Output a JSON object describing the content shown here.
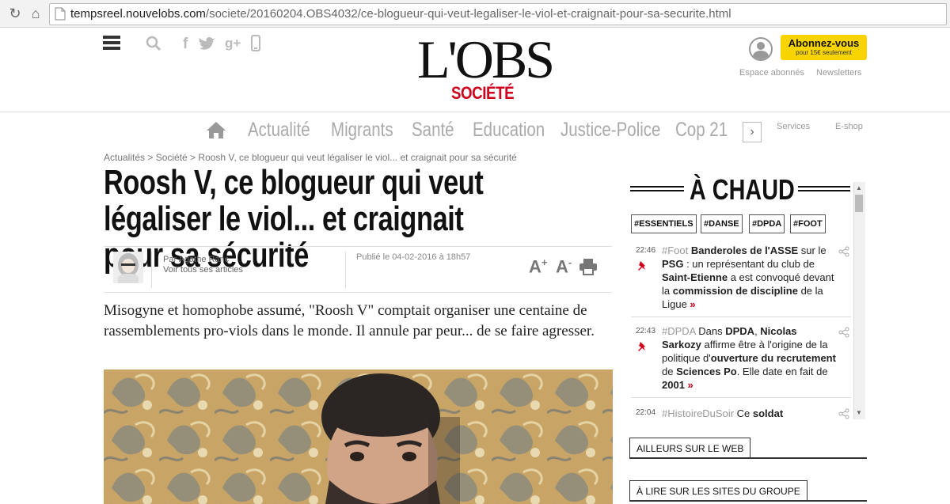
{
  "browser": {
    "url_host": "tempsreel.nouvelobs.com",
    "url_path": "/societe/20160204.OBS4032/ce-blogueur-qui-veut-legaliser-le-viol-et-craignait-pour-sa-securite.html"
  },
  "header": {
    "logo": "L'OBS",
    "section": "SOCIÉTÉ",
    "subscribe_label": "Abonnez-vous",
    "subscribe_sub": "pour 15€ seulement",
    "espace_abonnes": "Espace abonnés",
    "newsletters": "Newsletters",
    "share_icons": [
      "facebook-icon",
      "twitter-icon",
      "googleplus-icon",
      "mobile-icon"
    ]
  },
  "nav": {
    "items": [
      "Actualité",
      "Migrants",
      "Santé",
      "Education",
      "Justice-Police",
      "Cop 21"
    ],
    "services": "Services",
    "eshop": "E-shop"
  },
  "article": {
    "breadcrumb": "Actualités > Société > Roosh V, ce blogueur qui veut légaliser le viol... et craignait pour sa sécurité",
    "title": "Roosh V, ce blogueur qui veut légaliser le viol... et craignait pour sa sécurité",
    "author": "Par Agathe Ranc",
    "author_link": "Voir tous ses articles",
    "published": "Publié le 04-02-2016 à 18h57",
    "font_up": "A",
    "font_down": "A",
    "font_up_sign": "+",
    "font_down_sign": "-",
    "chapo": "Misogyne et homophobe assumé, \"Roosh V\" comptait organiser une centaine de rassemblements pro-viols dans le monde. Il annule par peur... de se faire agresser."
  },
  "sidebar": {
    "title": "À CHAUD",
    "tags": [
      "#ESSENTIELS",
      "#DANSE",
      "#DPDA",
      "#FOOT"
    ],
    "news": [
      {
        "time": "22:46",
        "hash": "#Foot",
        "parts": [
          " ",
          "Banderoles de l'ASSE",
          " sur le ",
          "PSG",
          " : un représentant du club de ",
          "Saint-Etienne",
          " a est convoqué devant la ",
          "commission de discipline",
          " de la Ligue "
        ]
      },
      {
        "time": "22:43",
        "hash": "#DPDA",
        "parts": [
          " Dans ",
          "DPDA",
          ", ",
          "Nicolas Sarkozy",
          " affirme être à l'origine de la politique d'",
          "ouverture du recrutement",
          " de ",
          "Sciences Po",
          ". Elle date en fait de ",
          "2001",
          " "
        ]
      },
      {
        "time": "22:04",
        "hash": "#HistoireDuSoir",
        "parts": [
          " Ce ",
          "soldat"
        ]
      }
    ],
    "more_symbol": "»",
    "ailleurs": "AILLEURS SUR LE WEB",
    "groupe": "À LIRE SUR LES SITES DU GROUPE"
  },
  "colors": {
    "accent_red": "#d0021b",
    "subscribe_yellow": "#f7d400"
  }
}
